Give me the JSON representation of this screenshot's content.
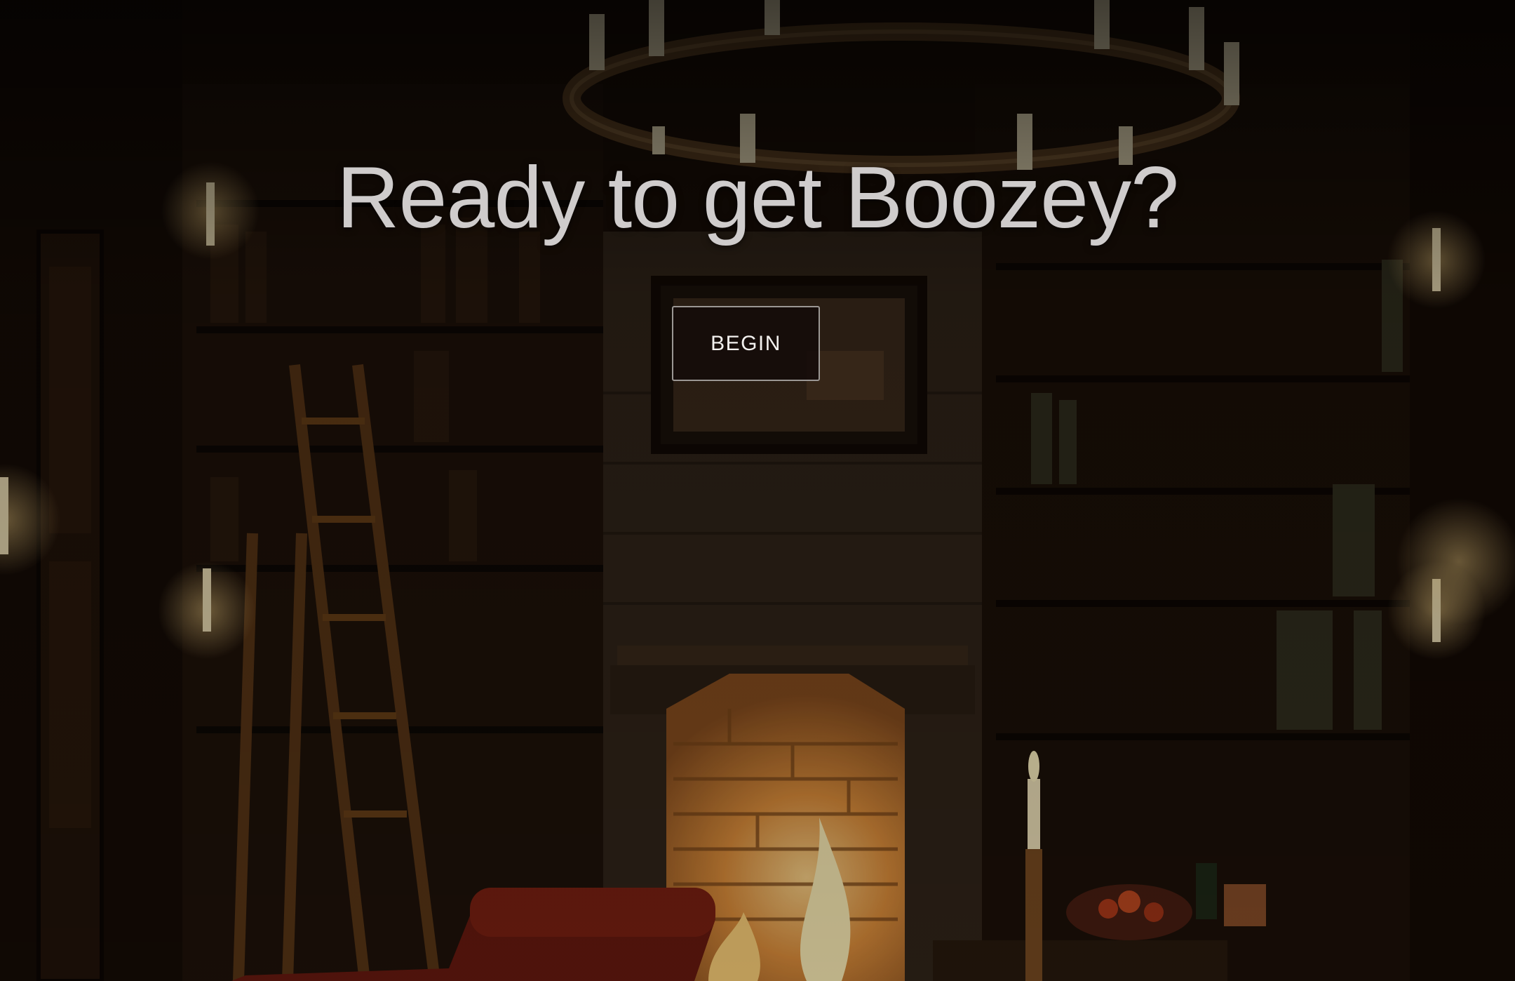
{
  "hero": {
    "headline": "Ready to get Boozey?",
    "begin_label": "BEGIN"
  },
  "background": {
    "description_icon": "library-fireplace-scene",
    "colors": {
      "fire": "#f5b24a",
      "candle": "#ffe9b0",
      "wood_dark": "#1c0f07",
      "stone": "#3a2c20"
    }
  }
}
